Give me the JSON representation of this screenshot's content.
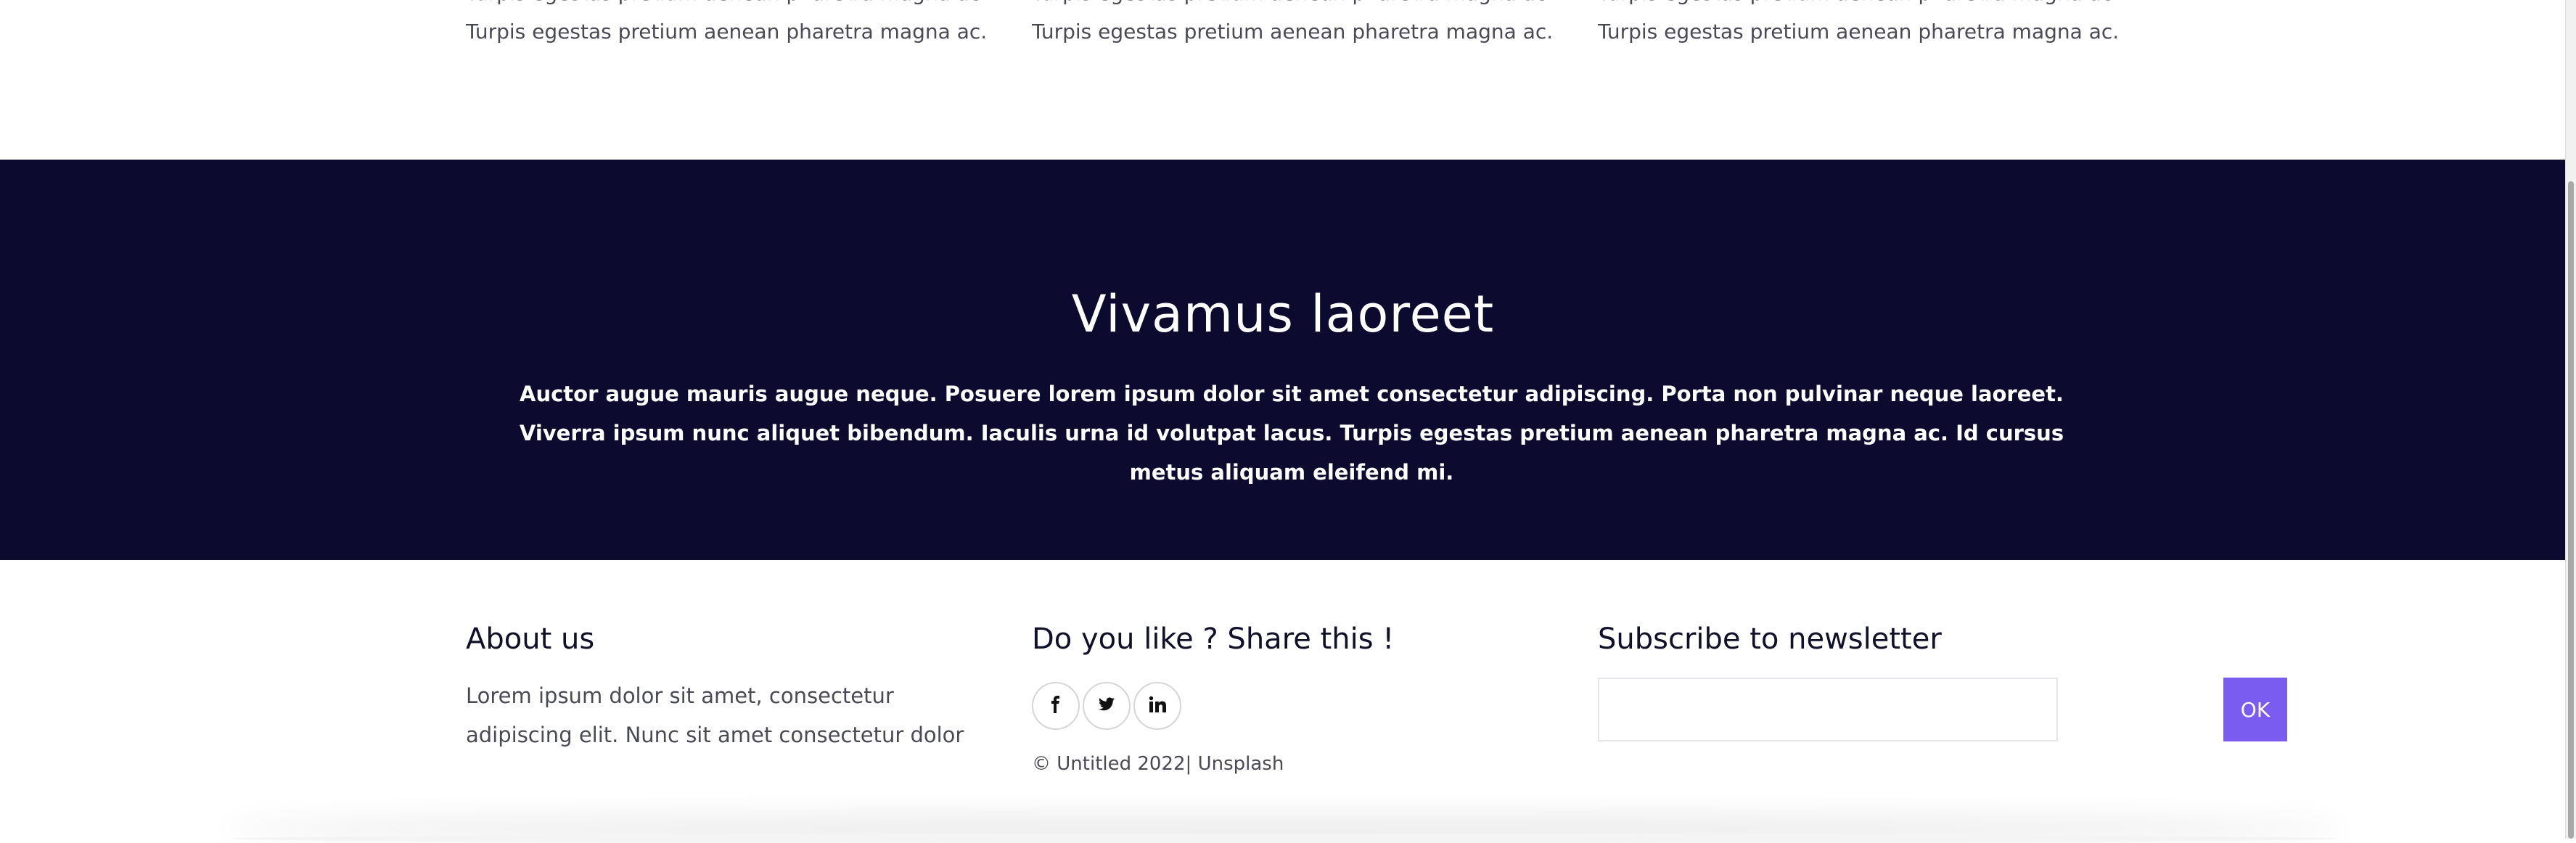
{
  "features": {
    "items": [
      {
        "cut_text": "Turpis egestas pretium aenean pharetra magna ac.",
        "text": "Turpis egestas pretium aenean pharetra magna ac."
      },
      {
        "cut_text": "Turpis egestas pretium aenean pharetra magna ac.",
        "text": "Turpis egestas pretium aenean pharetra magna ac."
      },
      {
        "cut_text": "Turpis egestas pretium aenean pharetra magna ac.",
        "text": "Turpis egestas pretium aenean pharetra magna ac."
      }
    ]
  },
  "hero": {
    "title": "Vivamus laoreet",
    "text": "Auctor augue mauris augue neque. Posuere lorem ipsum dolor sit amet consectetur adipiscing. Porta non pulvinar neque laoreet. Viverra ipsum nunc aliquet bibendum. Iaculis urna id volutpat lacus. Turpis egestas pretium aenean pharetra magna ac. Id cursus metus aliquam eleifend mi.",
    "background": "#0c0a2e"
  },
  "footer": {
    "about": {
      "title": "About us",
      "text": "Lorem ipsum dolor sit amet, consectetur adipiscing elit. Nunc sit amet consectetur dolor"
    },
    "share": {
      "title": "Do you like ? Share this !",
      "icons": [
        "facebook-icon",
        "twitter-icon",
        "linkedin-icon"
      ],
      "copyright": "© Untitled 2022| Unsplash"
    },
    "newsletter": {
      "title": "Subscribe to newsletter",
      "input_value": "",
      "button_label": "OK",
      "accent": "#7b5cf0"
    }
  }
}
